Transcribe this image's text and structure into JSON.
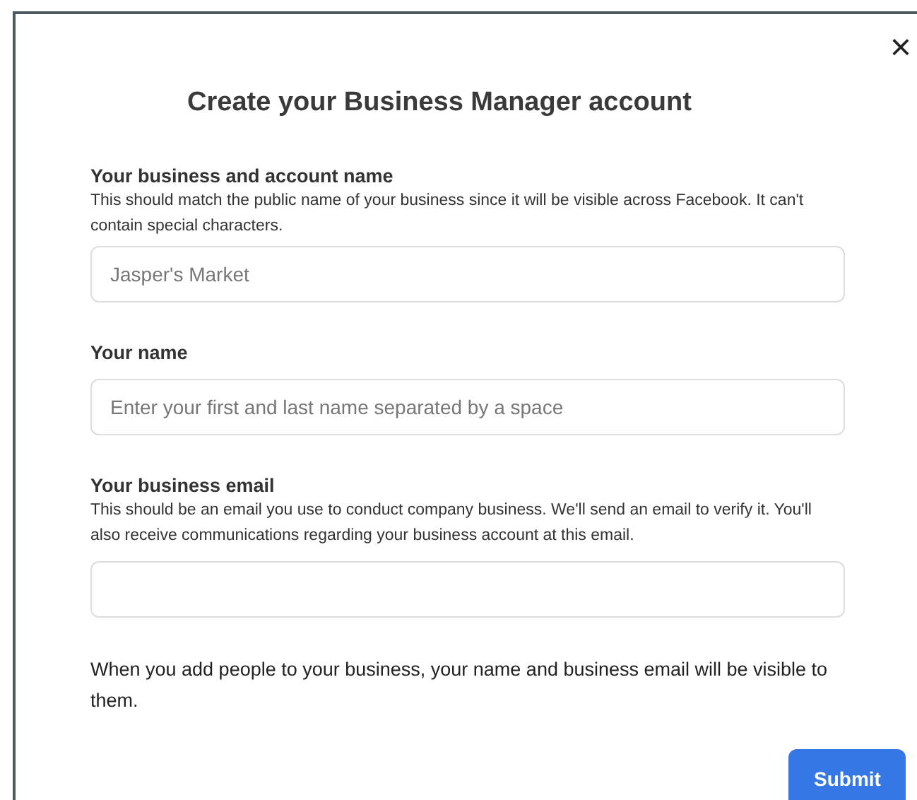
{
  "dialog": {
    "title": "Create your Business Manager account",
    "close": "×",
    "fields": [
      {
        "label": "Your business and account name",
        "help": "This should match the public name of your business since it will be visible across Facebook. It can't contain special characters.",
        "placeholder": "Jasper's Market"
      },
      {
        "label": "Your name",
        "placeholder": "Enter your first and last name separated by a space"
      },
      {
        "label": "Your business email",
        "help": "This should be an email you use to conduct company business. We'll send an email to verify it. You'll also receive communications regarding your business account at this email."
      }
    ],
    "note": "When you add people to your business, your name and business email will be visible to them.",
    "buttons": [
      "Submit"
    ]
  }
}
